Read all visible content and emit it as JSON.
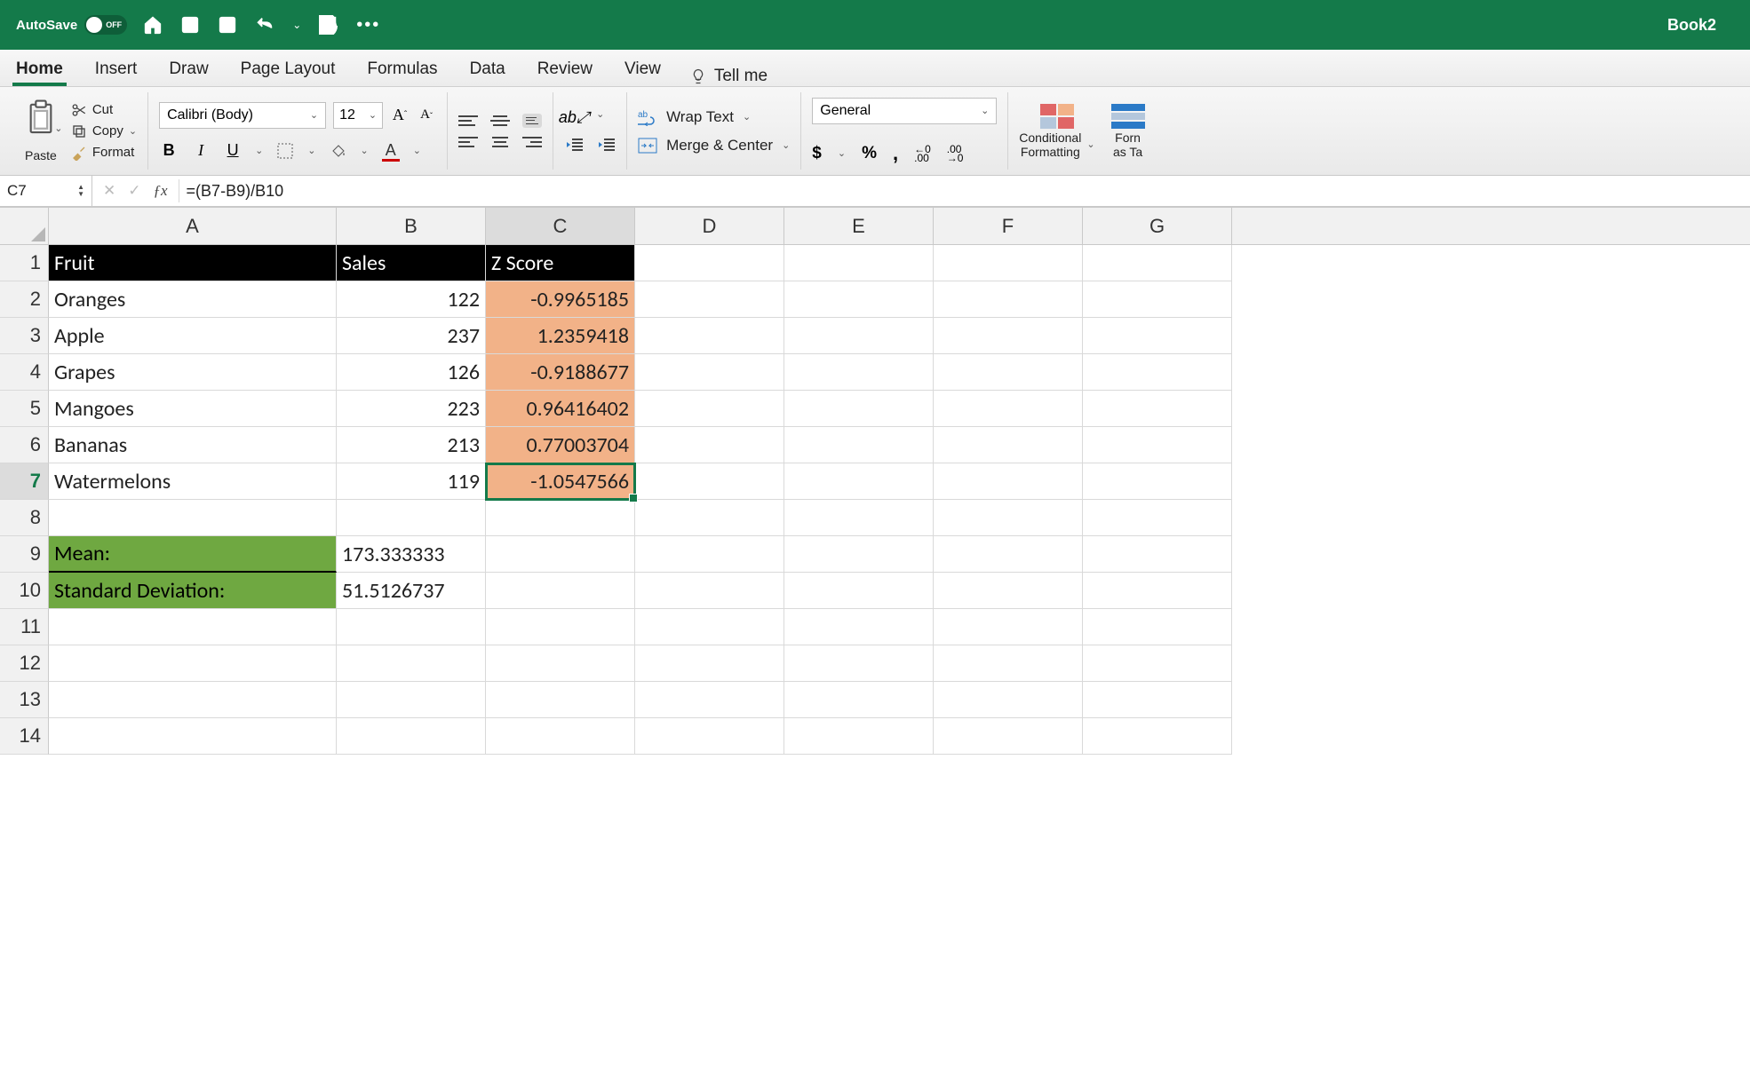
{
  "titlebar": {
    "autosave_label": "AutoSave",
    "autosave_toggle": "OFF",
    "book_title": "Book2"
  },
  "tabs": {
    "home": "Home",
    "insert": "Insert",
    "draw": "Draw",
    "page_layout": "Page Layout",
    "formulas": "Formulas",
    "data": "Data",
    "review": "Review",
    "view": "View",
    "tell_me": "Tell me"
  },
  "ribbon": {
    "paste": "Paste",
    "cut": "Cut",
    "copy": "Copy",
    "format": "Format",
    "font_name": "Calibri (Body)",
    "font_size": "12",
    "wrap_text": "Wrap Text",
    "merge_center": "Merge & Center",
    "number_format": "General",
    "conditional_formatting_l1": "Conditional",
    "conditional_formatting_l2": "Formatting",
    "format_as_l1": "Forn",
    "format_as_l2": "as Ta"
  },
  "formula_bar": {
    "name_box": "C7",
    "formula": "=(B7-B9)/B10"
  },
  "columns": [
    "A",
    "B",
    "C",
    "D",
    "E",
    "F",
    "G"
  ],
  "rows": [
    "1",
    "2",
    "3",
    "4",
    "5",
    "6",
    "7",
    "8",
    "9",
    "10",
    "11",
    "12",
    "13",
    "14"
  ],
  "sheet": {
    "header": {
      "a": "Fruit",
      "b": "Sales",
      "c": "Z Score"
    },
    "data_rows": [
      {
        "a": "Oranges",
        "b": "122",
        "c": "-0.9965185"
      },
      {
        "a": "Apple",
        "b": "237",
        "c": "1.2359418"
      },
      {
        "a": "Grapes",
        "b": "126",
        "c": "-0.9188677"
      },
      {
        "a": "Mangoes",
        "b": "223",
        "c": "0.96416402"
      },
      {
        "a": "Bananas",
        "b": "213",
        "c": "0.77003704"
      },
      {
        "a": "Watermelons",
        "b": "119",
        "c": "-1.0547566"
      }
    ],
    "mean_label": "Mean:",
    "mean_value": "173.333333",
    "std_label": "Standard Deviation:",
    "std_value": "51.5126737"
  }
}
